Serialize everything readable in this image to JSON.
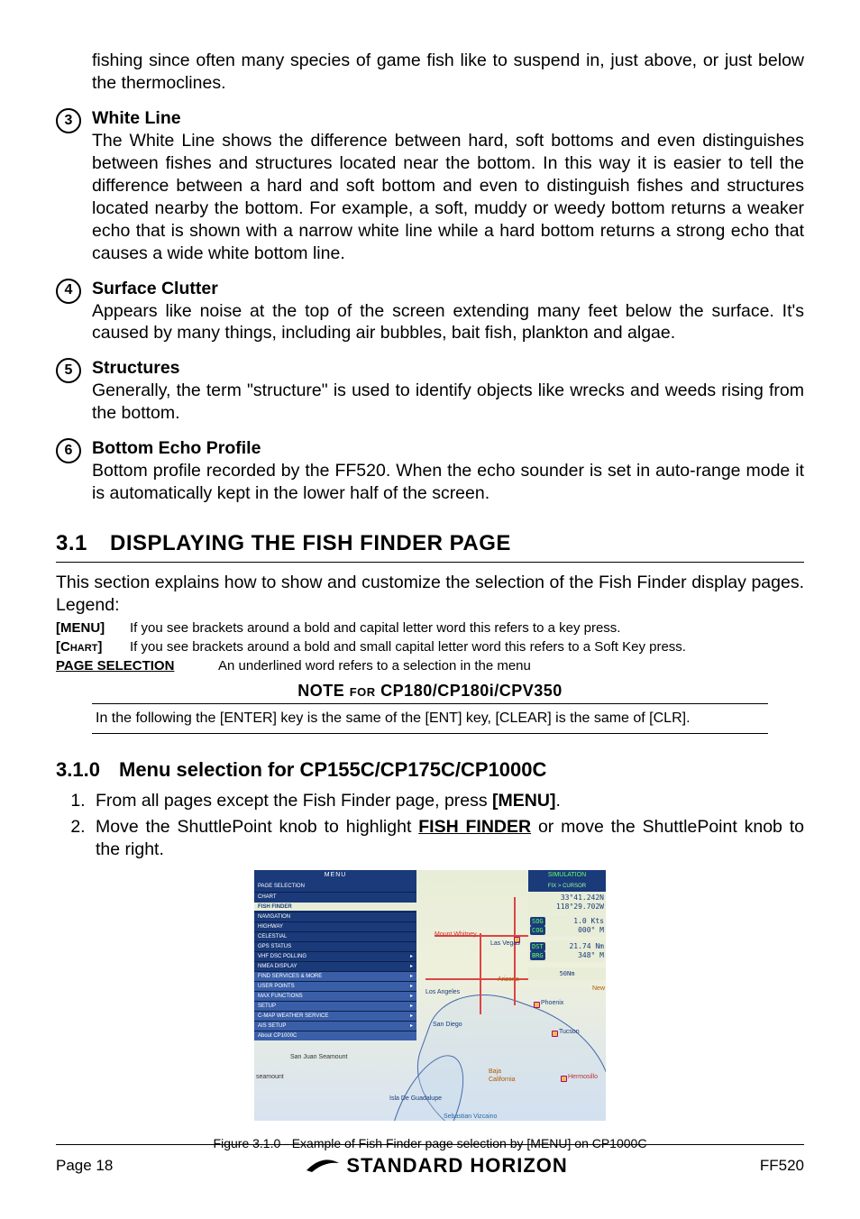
{
  "intro_cont": "fishing since often many species of game fish like to suspend in, just above, or just below the thermoclines.",
  "items": [
    {
      "n": "3",
      "title": "White Line",
      "body": "The White Line shows the difference between hard, soft bottoms and even distinguishes between fishes and structures located near the bottom. In this way it is easier to tell the difference between a hard and soft bottom and even to distinguish fishes and structures located nearby the bottom. For example, a soft, muddy or weedy bottom returns a weaker echo that is shown with a narrow white line while a hard bottom returns a strong echo that causes a wide white bottom line."
    },
    {
      "n": "4",
      "title": "Surface Clutter",
      "body": "Appears like noise at the top of the screen extending many feet below the surface. It's caused by many things, including air bubbles, bait fish, plankton and algae."
    },
    {
      "n": "5",
      "title": "Structures",
      "body": "Generally, the term \"structure\" is used to identify objects like wrecks and weeds rising from the bottom."
    },
    {
      "n": "6",
      "title": "Bottom Echo Profile",
      "body": "Bottom profile recorded by the FF520. When the echo sounder is set in auto-range mode it is automatically kept in the lower half of the screen."
    }
  ],
  "sec31": {
    "num": "3.1",
    "title": "DISPLAYING THE FISH FINDER PAGE"
  },
  "sec31_intro": "This section explains how to show and customize the selection of the Fish Finder display pages. Legend:",
  "legend": [
    {
      "key": "[MENU]",
      "cls": "",
      "body": "If you see brackets around a bold and capital letter word this refers to a key press."
    },
    {
      "key": "[Chart]",
      "cls": "sc",
      "body": "If you see brackets around a bold and small capital letter word this refers to a Soft Key press."
    }
  ],
  "legend3": {
    "key": "PAGE SELECTION",
    "body": "An underlined word refers to a selection in the menu"
  },
  "note": {
    "title_pre": "NOTE ",
    "title_for": "for",
    "title_post": " CP180/CP180i/CPV350",
    "body": "In the following the [ENTER] key is the same of the [ENT] key,  [CLEAR] is the same of [CLR]."
  },
  "sub310": {
    "num": "3.1.0",
    "title": "Menu selection for CP155C/CP175C/CP1000C"
  },
  "steps": {
    "s1_a": "From all pages except the Fish Finder page, press ",
    "s1_b": "[MENU]",
    "s1_c": ".",
    "s2_a": "Move the ShuttlePoint knob to highlight ",
    "s2_b": "FISH FINDER",
    "s2_c": " or move the ShuttlePoint knob to the right."
  },
  "fig_cap": "Figure  3.1.0 - Example of Fish Finder page selection by [MENU]  on CP1000C",
  "footer": {
    "page": "Page  18",
    "brand": "STANDARD HORIZON",
    "right": "FF520"
  },
  "shot": {
    "menu_title": "MENU",
    "page_sel": "PAGE SELECTION",
    "rows": [
      "CHART",
      "FISH FINDER",
      "NAVIGATION",
      "HIGHWAY",
      "CELESTIAL",
      "GPS STATUS",
      "VHF DSC POLLING",
      "NMEA DISPLAY",
      "FIND SERVICES & MORE",
      "USER POINTS",
      "MAX FUNCTIONS",
      "SETUP",
      "C-MAP WEATHER SERVICE",
      "AIS SETUP",
      "About CP1000C"
    ],
    "sim": "SIMULATION",
    "fix": "FIX > CURSOR",
    "lat": "33°41.242N",
    "lon": "118°29.702W",
    "sog": "1.0 Kts",
    "cog": "000°  M",
    "dst": "21.74  Nm",
    "brg": "348°  M",
    "scale": "50Nm",
    "mtwhitney": "Mount Whitney",
    "lasvegas": "Las Vegas",
    "arizona": "Arizona",
    "newm": "New",
    "phoenix": "Phoenix",
    "tucson": "Tucson",
    "hermosillo": "Hermosillo",
    "baja": "Baja\nCalifornia",
    "guadalupe": "Isla De Guadalupe",
    "vizcaino": "Sebastian Vizcaino",
    "sanjuan": "San Juan Seamount",
    "seamount": "seamount",
    "la": "Los Angeles",
    "sd": "San Diego"
  }
}
